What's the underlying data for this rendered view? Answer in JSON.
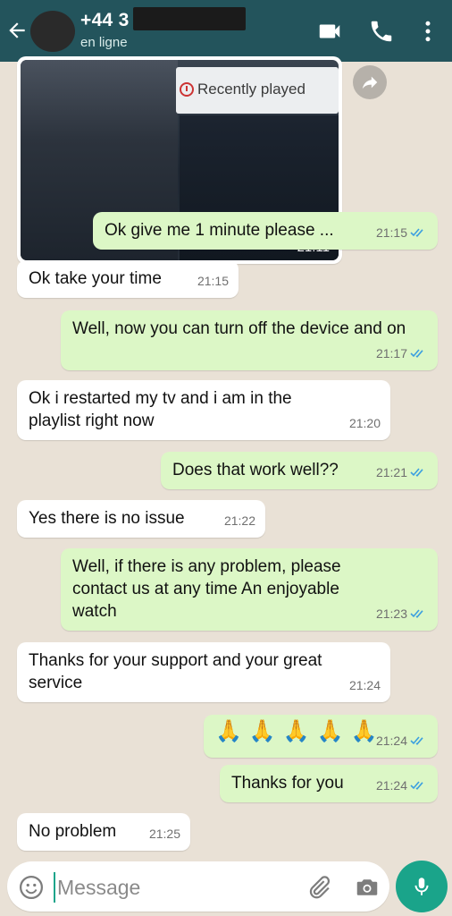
{
  "header": {
    "contact_number": "+44 3",
    "contact_status": "en ligne"
  },
  "icons": {
    "back": "arrow-left-icon",
    "video": "video-call-icon",
    "phone": "phone-icon",
    "menu": "more-vertical-icon",
    "forward": "forward-icon",
    "emoji": "emoji-icon",
    "attach": "paperclip-icon",
    "camera": "camera-icon",
    "mic": "microphone-icon"
  },
  "colors": {
    "header": "#23545c",
    "outgoing_bubble": "#dcf7c6",
    "incoming_bubble": "#ffffff",
    "accent": "#1aa48a",
    "read_ticks": "#3b9fe0"
  },
  "media_message": {
    "overlay_label": "Recently played",
    "time": "21:11"
  },
  "messages": [
    {
      "dir": "out",
      "text": "Ok give me 1 minute please ...",
      "time": "21:15"
    },
    {
      "dir": "in",
      "text": "Ok take your time",
      "time": "21:15"
    },
    {
      "dir": "out",
      "text": "Well, now you can turn off the device and on",
      "time": "21:17"
    },
    {
      "dir": "in",
      "text": "Ok i restarted my tv and i am in the playlist right now",
      "time": "21:20"
    },
    {
      "dir": "out",
      "text": "Does that work well??",
      "time": "21:21"
    },
    {
      "dir": "in",
      "text": "Yes there is no issue",
      "time": "21:22"
    },
    {
      "dir": "out",
      "text": "Well, if there is any problem, please contact us at any time An enjoyable watch",
      "time": "21:23"
    },
    {
      "dir": "in",
      "text": "Thanks for your support and your great service",
      "time": "21:24"
    },
    {
      "dir": "out",
      "text": "🙏🙏🙏🙏🙏",
      "time": "21:24"
    },
    {
      "dir": "out",
      "text": "Thanks for you",
      "time": "21:24"
    },
    {
      "dir": "in",
      "text": "No problem",
      "time": "21:25"
    }
  ],
  "composer": {
    "placeholder": "Message"
  }
}
